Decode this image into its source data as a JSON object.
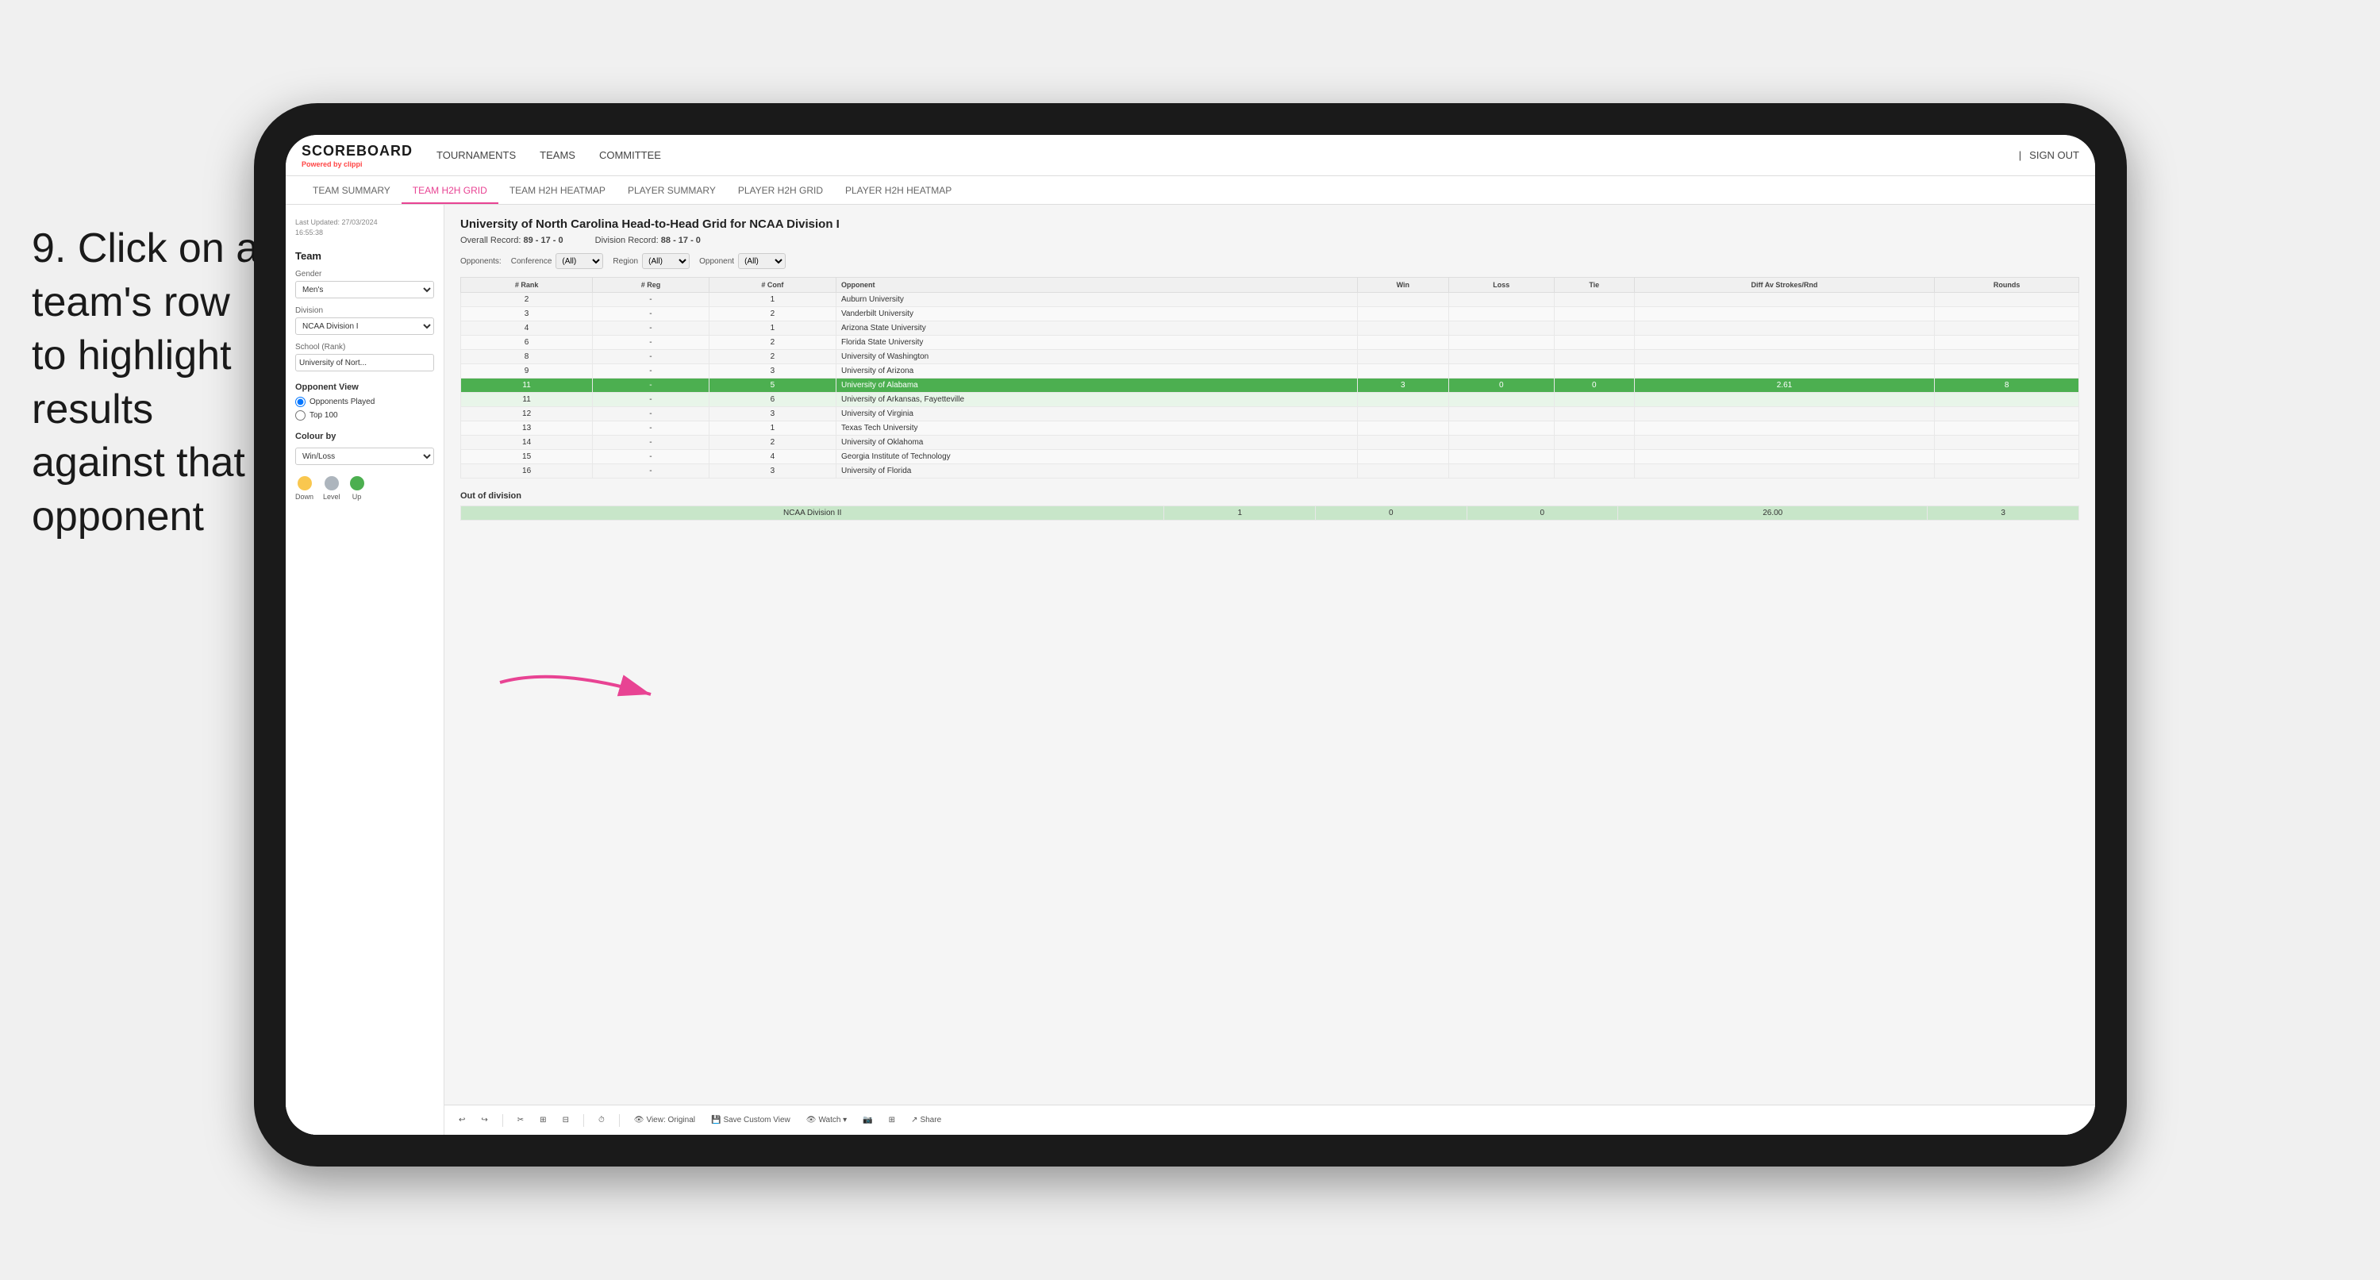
{
  "instruction": {
    "step": "9.",
    "text": "Click on a team's row to highlight results against that opponent"
  },
  "nav": {
    "logo": "SCOREBOARD",
    "powered_by": "Powered by",
    "brand": "clippi",
    "items": [
      "TOURNAMENTS",
      "TEAMS",
      "COMMITTEE"
    ],
    "sign_in_separator": "|",
    "sign_out": "Sign out"
  },
  "sub_nav": {
    "items": [
      "TEAM SUMMARY",
      "TEAM H2H GRID",
      "TEAM H2H HEATMAP",
      "PLAYER SUMMARY",
      "PLAYER H2H GRID",
      "PLAYER H2H HEATMAP"
    ],
    "active": "TEAM H2H GRID"
  },
  "sidebar": {
    "last_updated_label": "Last Updated: 27/03/2024",
    "time": "16:55:38",
    "team_label": "Team",
    "gender_label": "Gender",
    "gender_value": "Men's",
    "division_label": "Division",
    "division_value": "NCAA Division I",
    "school_rank_label": "School (Rank)",
    "school_value": "University of Nort...",
    "opponent_view_title": "Opponent View",
    "radio1": "Opponents Played",
    "radio2": "Top 100",
    "colour_by_title": "Colour by",
    "colour_by_value": "Win/Loss",
    "legend": [
      {
        "label": "Down",
        "color": "#f9c74f"
      },
      {
        "label": "Level",
        "color": "#adb5bd"
      },
      {
        "label": "Up",
        "color": "#4caf50"
      }
    ]
  },
  "grid": {
    "title": "University of North Carolina Head-to-Head Grid for NCAA Division I",
    "overall_record_label": "Overall Record:",
    "overall_record": "89 - 17 - 0",
    "division_record_label": "Division Record:",
    "division_record": "88 - 17 - 0",
    "conference_label": "Conference",
    "conference_value": "(All)",
    "region_label": "Region",
    "region_value": "(All)",
    "opponent_label": "Opponent",
    "opponent_value": "(All)",
    "opponents_label": "Opponents:",
    "columns": {
      "rank": "# Rank",
      "reg": "# Reg",
      "conf": "# Conf",
      "opponent": "Opponent",
      "win": "Win",
      "loss": "Loss",
      "tie": "Tie",
      "diff_av": "Diff Av Strokes/Rnd",
      "rounds": "Rounds"
    },
    "rows": [
      {
        "rank": "2",
        "reg": "-",
        "conf": "1",
        "opponent": "Auburn University",
        "win": "",
        "loss": "",
        "tie": "",
        "diff": "",
        "rounds": "",
        "style": "normal"
      },
      {
        "rank": "3",
        "reg": "-",
        "conf": "2",
        "opponent": "Vanderbilt University",
        "win": "",
        "loss": "",
        "tie": "",
        "diff": "",
        "rounds": "",
        "style": "light"
      },
      {
        "rank": "4",
        "reg": "-",
        "conf": "1",
        "opponent": "Arizona State University",
        "win": "",
        "loss": "",
        "tie": "",
        "diff": "",
        "rounds": "",
        "style": "normal"
      },
      {
        "rank": "6",
        "reg": "-",
        "conf": "2",
        "opponent": "Florida State University",
        "win": "",
        "loss": "",
        "tie": "",
        "diff": "",
        "rounds": "",
        "style": "light"
      },
      {
        "rank": "8",
        "reg": "-",
        "conf": "2",
        "opponent": "University of Washington",
        "win": "",
        "loss": "",
        "tie": "",
        "diff": "",
        "rounds": "",
        "style": "normal"
      },
      {
        "rank": "9",
        "reg": "-",
        "conf": "3",
        "opponent": "University of Arizona",
        "win": "",
        "loss": "",
        "tie": "",
        "diff": "",
        "rounds": "",
        "style": "light"
      },
      {
        "rank": "11",
        "reg": "-",
        "conf": "5",
        "opponent": "University of Alabama",
        "win": "3",
        "loss": "0",
        "tie": "0",
        "diff": "2.61",
        "rounds": "8",
        "style": "highlighted"
      },
      {
        "rank": "11",
        "reg": "-",
        "conf": "6",
        "opponent": "University of Arkansas, Fayetteville",
        "win": "",
        "loss": "",
        "tie": "",
        "diff": "",
        "rounds": "",
        "style": "light-green"
      },
      {
        "rank": "12",
        "reg": "-",
        "conf": "3",
        "opponent": "University of Virginia",
        "win": "",
        "loss": "",
        "tie": "",
        "diff": "",
        "rounds": "",
        "style": "normal"
      },
      {
        "rank": "13",
        "reg": "-",
        "conf": "1",
        "opponent": "Texas Tech University",
        "win": "",
        "loss": "",
        "tie": "",
        "diff": "",
        "rounds": "",
        "style": "light"
      },
      {
        "rank": "14",
        "reg": "-",
        "conf": "2",
        "opponent": "University of Oklahoma",
        "win": "",
        "loss": "",
        "tie": "",
        "diff": "",
        "rounds": "",
        "style": "normal"
      },
      {
        "rank": "15",
        "reg": "-",
        "conf": "4",
        "opponent": "Georgia Institute of Technology",
        "win": "",
        "loss": "",
        "tie": "",
        "diff": "",
        "rounds": "",
        "style": "light"
      },
      {
        "rank": "16",
        "reg": "-",
        "conf": "3",
        "opponent": "University of Florida",
        "win": "",
        "loss": "",
        "tie": "",
        "diff": "",
        "rounds": "",
        "style": "normal"
      }
    ],
    "out_of_division_label": "Out of division",
    "out_of_division_rows": [
      {
        "division": "NCAA Division II",
        "win": "1",
        "loss": "0",
        "tie": "0",
        "diff": "26.00",
        "rounds": "3",
        "style": "out-div"
      }
    ]
  },
  "toolbar": {
    "undo": "↩",
    "redo": "↪",
    "view_original": "View: Original",
    "save_custom": "Save Custom View",
    "watch": "Watch ▾",
    "share": "Share"
  }
}
